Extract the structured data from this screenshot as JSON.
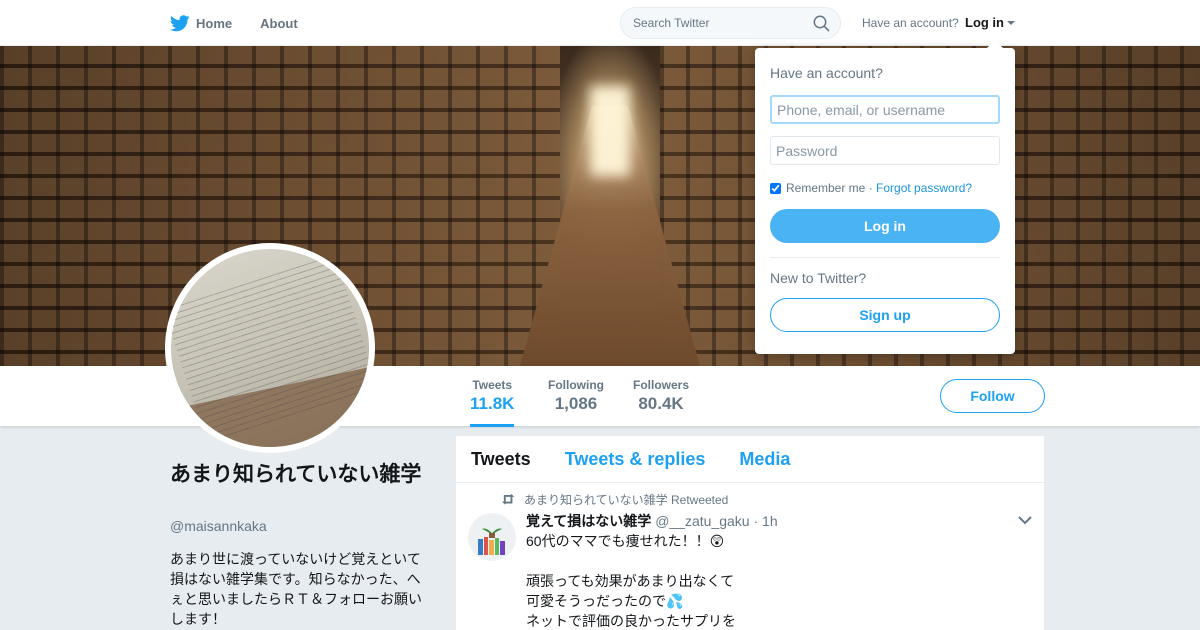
{
  "nav": {
    "home_label": "Home",
    "about_label": "About",
    "search_placeholder": "Search Twitter",
    "have_account": "Have an account?",
    "login_label": "Log in"
  },
  "profile": {
    "name": "あまり知られていない雑学",
    "handle": "@maisannkaka",
    "bio": "あまり世に渡っていないけど覚えといて損はない雑学集です。知らなかった、へぇと思いましたらＲＴ＆フォローお願いします！",
    "stats": [
      {
        "label": "Tweets",
        "value": "11.8K"
      },
      {
        "label": "Following",
        "value": "1,086"
      },
      {
        "label": "Followers",
        "value": "80.4K"
      }
    ],
    "follow_label": "Follow"
  },
  "timeline": {
    "tabs": [
      "Tweets",
      "Tweets & replies",
      "Media"
    ],
    "tweet": {
      "retweet_note": "あまり知られていない雑学 Retweeted",
      "name": "覚えて損はない雑学",
      "handle": "@__zatu_gaku",
      "time": "· 1h",
      "lines": [
        "60代のママでも痩せれた！！😲",
        "",
        "頑張っても効果があまり出なくて",
        "可愛そうっだったので💦",
        "ネットで評価の良かったサプリを"
      ]
    }
  },
  "login_popup": {
    "title": "Have an account?",
    "username_placeholder": "Phone, email, or username",
    "password_placeholder": "Password",
    "remember": "Remember me",
    "separator": " · ",
    "forgot": "Forgot password?",
    "login_button": "Log in",
    "new_to": "New to Twitter?",
    "signup_button": "Sign up"
  },
  "colors": {
    "accent": "#1da1f2",
    "background": "#e6ecf0",
    "text_secondary": "#657786"
  }
}
